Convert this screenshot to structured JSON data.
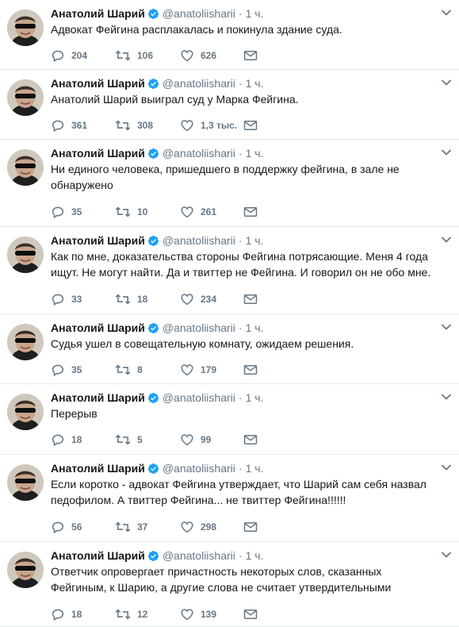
{
  "feed": {
    "tweets": [
      {
        "name": "Анатолий Шарий",
        "handle": "@anatoliisharii",
        "time": "1 ч.",
        "text": "Адвокат Фейгина расплакалась и покинула здание суда.",
        "replies": "204",
        "retweets": "106",
        "likes": "626"
      },
      {
        "name": "Анатолий Шарий",
        "handle": "@anatoliisharii",
        "time": "1 ч.",
        "text": "Анатолий Шарий выиграл суд у Марка Фейгина.",
        "replies": "361",
        "retweets": "308",
        "likes": "1,3 тыс."
      },
      {
        "name": "Анатолий Шарий",
        "handle": "@anatoliisharii",
        "time": "1 ч.",
        "text": "Ни единого человека, пришедшего в поддержку фейгина, в зале не\nобнаружено",
        "replies": "35",
        "retweets": "10",
        "likes": "261"
      },
      {
        "name": "Анатолий Шарий",
        "handle": "@anatoliisharii",
        "time": "1 ч.",
        "text": "Как по мне, доказательства стороны Фейгина потрясающие. Меня 4 года\nищут. Не могут найти. Да и твиттер не Фейгина. И говорил он не обо мне.",
        "replies": "33",
        "retweets": "18",
        "likes": "234"
      },
      {
        "name": "Анатолий Шарий",
        "handle": "@anatoliisharii",
        "time": "1 ч.",
        "text": "Судья ушел в совещательную комнату, ожидаем решения.",
        "replies": "35",
        "retweets": "8",
        "likes": "179"
      },
      {
        "name": "Анатолий Шарий",
        "handle": "@anatoliisharii",
        "time": "1 ч.",
        "text": "Перерыв",
        "replies": "18",
        "retweets": "5",
        "likes": "99"
      },
      {
        "name": "Анатолий Шарий",
        "handle": "@anatoliisharii",
        "time": "1 ч.",
        "text": "Если коротко - адвокат Фейгина утверждает, что Шарий сам себя назвал\nпедофилом. А твиттер Фейгина... не твиттер Фейгина!!!!!!",
        "replies": "56",
        "retweets": "37",
        "likes": "298"
      },
      {
        "name": "Анатолий Шарий",
        "handle": "@anatoliisharii",
        "time": "1 ч.",
        "text": "Ответчик опровергает причастность некоторых слов, сказанных\nФейгиным,  к Шарию, а другие слова не считает утвердительными",
        "replies": "18",
        "retweets": "12",
        "likes": "139"
      }
    ]
  },
  "colors": {
    "text": "#14171a",
    "secondary": "#657786",
    "verified": "#1da1f2",
    "border": "#e6ecf0"
  },
  "icons": {
    "reply": "reply-icon",
    "retweet": "retweet-icon",
    "like": "like-icon",
    "dm": "direct-message-icon",
    "verified": "verified-badge-icon",
    "caret": "chevron-down-icon"
  }
}
